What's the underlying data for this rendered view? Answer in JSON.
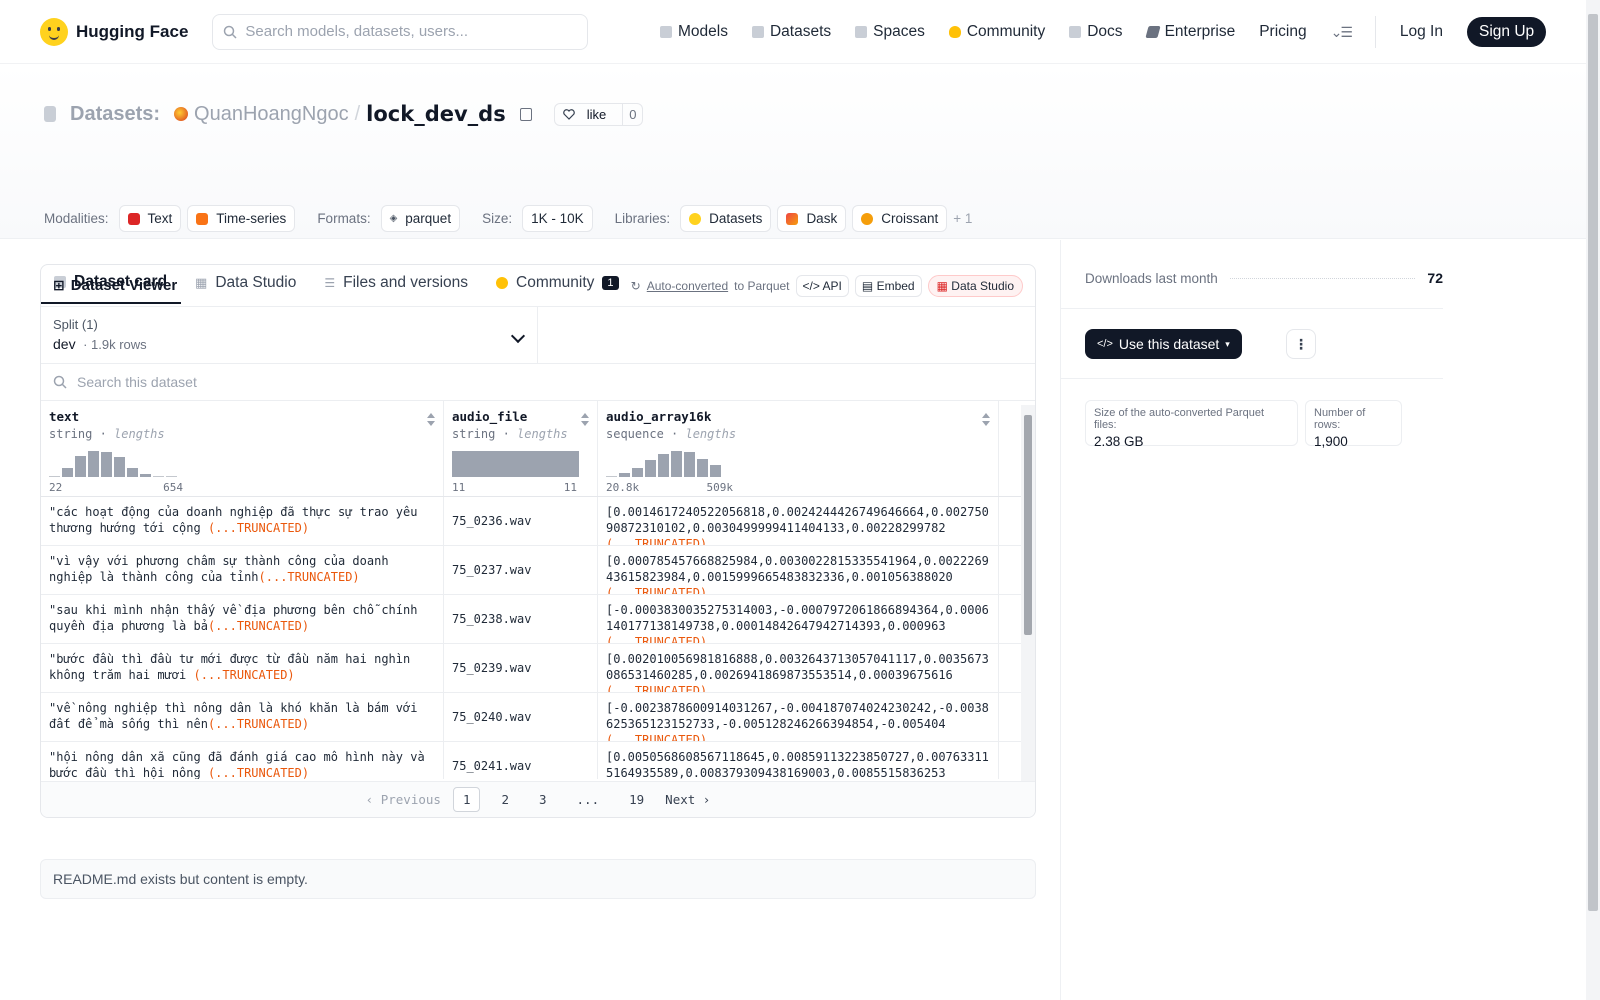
{
  "nav": {
    "brand": "Hugging Face",
    "search_placeholder": "Search models, datasets, users...",
    "links": [
      "Models",
      "Datasets",
      "Spaces",
      "Community",
      "Docs",
      "Enterprise",
      "Pricing"
    ],
    "login": "Log In",
    "signup": "Sign Up"
  },
  "header": {
    "label": "Datasets:",
    "owner": "QuanHoangNgoc",
    "name": "lock_dev_ds",
    "like_label": "like",
    "like_count": "0",
    "modalities_label": "Modalities:",
    "modalities": [
      "Text",
      "Time-series"
    ],
    "formats_label": "Formats:",
    "formats": [
      "parquet"
    ],
    "size_label": "Size:",
    "size": "1K - 10K",
    "libraries_label": "Libraries:",
    "libraries": [
      "Datasets",
      "Dask",
      "Croissant"
    ],
    "libraries_more": "+ 1"
  },
  "tabs": [
    {
      "label": "Dataset card",
      "active": true
    },
    {
      "label": "Data Studio"
    },
    {
      "label": "Files and versions"
    },
    {
      "label": "Community",
      "badge": "1"
    }
  ],
  "viewer": {
    "title": "Dataset Viewer",
    "auto_converted": "Auto-converted",
    "to_parquet": "to Parquet",
    "api": "API",
    "embed": "Embed",
    "data_studio": "Data Studio",
    "split_label": "Split (1)",
    "split_name": "dev",
    "split_rows": "1.9k rows",
    "search_placeholder": "Search this dataset",
    "columns": [
      {
        "name": "text",
        "type": "string",
        "stat": "lengths",
        "min": "22",
        "max": "654",
        "hist": [
          0.05,
          0.35,
          0.8,
          1.0,
          0.95,
          0.75,
          0.35,
          0.1,
          0.03,
          0.02
        ]
      },
      {
        "name": "audio_file",
        "type": "string",
        "stat": "lengths",
        "min": "11",
        "max": "11",
        "hist": [
          1.0
        ]
      },
      {
        "name": "audio_array16k",
        "type": "sequence",
        "stat": "lengths",
        "min": "20.8k",
        "max": "509k",
        "hist": [
          0.05,
          0.15,
          0.35,
          0.65,
          0.9,
          1.0,
          0.95,
          0.7,
          0.45
        ]
      }
    ],
    "truncated": "(...TRUNCATED)",
    "rows": [
      {
        "text": "\"các hoạt động của doanh nghiệp đã thực sự trao yêu thương hướng tới cộng ",
        "file": "75_0236.wav",
        "arr": "[0.0014617240522056818,0.0024244426749646664,0.00275090872310102,0.0030499999411404133,0.00228299782"
      },
      {
        "text": "\"vì vậy với phương châm sự thành công của doanh nghiệp là thành công của tỉnh",
        "file": "75_0237.wav",
        "arr": "[0.000785457668825984,0.0030022815335541964,0.002226943615823984,0.0015999665483832336,0.001056388020"
      },
      {
        "text": "\"sau khi mình nhận thấy về địa phương bên chỗ chính quyền địa phương là bả",
        "file": "75_0238.wav",
        "arr": "[-0.0003830035275314003,-0.0007972061866894364,0.0006140177138149738,0.00014842647942714393,0.000963"
      },
      {
        "text": "\"bước đầu thì đầu tư mới được từ đầu năm hai nghìn không trăm hai mươi ",
        "file": "75_0239.wav",
        "arr": "[0.002010056981816888,0.0032643713057041117,0.0035673086531460285,0.0026941869873553514,0.00039675616"
      },
      {
        "text": "\"về nông nghiệp thì nông dân là khó khăn là bám với đất để mà sống thì nên",
        "file": "75_0240.wav",
        "arr": "[-0.0023878600914031267,-0.004187074024230242,-0.0038625365123152733,-0.005128246266394854,-0.005404"
      },
      {
        "text": "\"hội nông dân xã cũng đã đánh giá cao mô hình này và bước đầu thì hội nông ",
        "file": "75_0241.wav",
        "arr": "[0.0050568608567118645,0.00859113223850727,0.007633115164935589,0.008379309438169003,0.0085515836253"
      }
    ],
    "pager": {
      "prev": "Previous",
      "pages": [
        "1",
        "2",
        "3",
        "...",
        "19"
      ],
      "next": "Next",
      "current": "1"
    }
  },
  "readme": "README.md exists but content is empty.",
  "sidebar": {
    "downloads_label": "Downloads last month",
    "downloads": "72",
    "use_button": "Use this dataset",
    "parquet_size_label": "Size of the auto-converted Parquet files:",
    "parquet_size": "2.38 GB",
    "rows_label": "Number of rows:",
    "rows": "1,900"
  }
}
